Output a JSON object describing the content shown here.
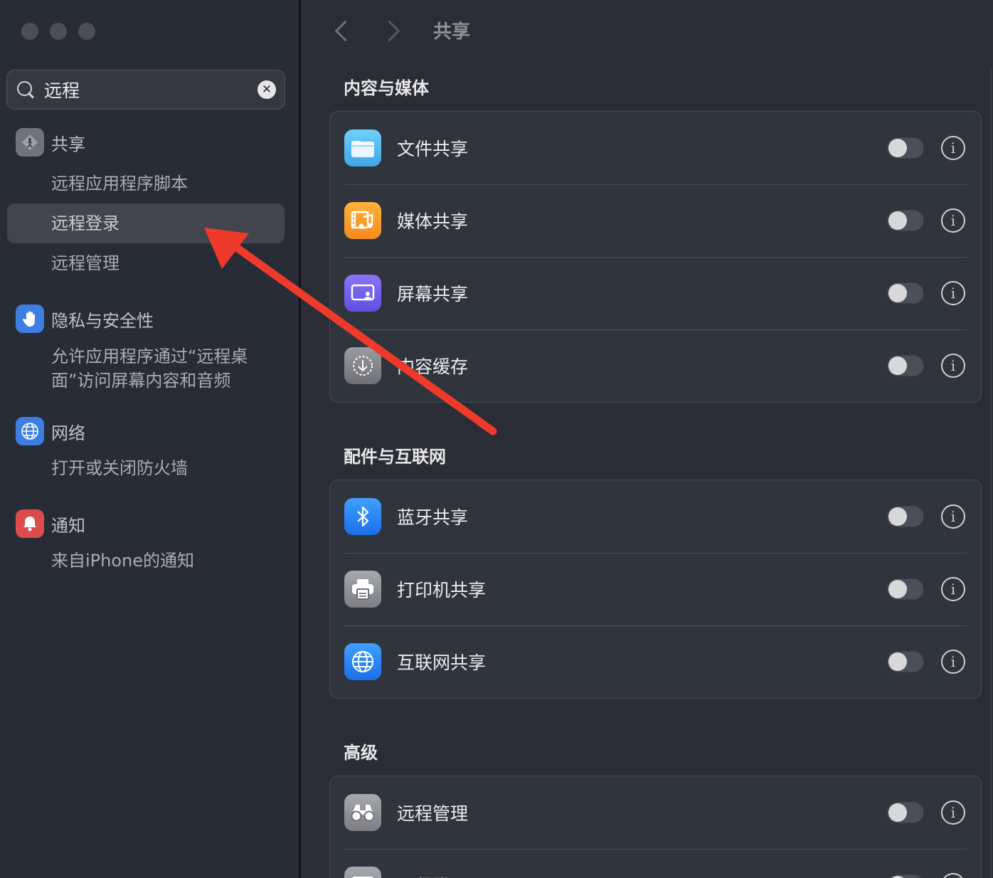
{
  "search": {
    "query": "远程",
    "clear_icon": "xmark-circle-icon"
  },
  "sidebar": {
    "groups": [
      {
        "label": "共享",
        "icon": "sharing-icon",
        "color": "#7b7f88",
        "sub": [
          "远程应用程序脚本",
          "远程登录",
          "远程管理"
        ]
      },
      {
        "label": "隐私与安全性",
        "icon": "hand-icon",
        "color": "#3d7ee0",
        "sub": [
          "允许应用程序通过“远程桌面”访问屏幕内容和音频"
        ]
      },
      {
        "label": "网络",
        "icon": "globe-icon",
        "color": "#3d7ee0",
        "sub": [
          "打开或关闭防火墙"
        ]
      },
      {
        "label": "通知",
        "icon": "bell-icon",
        "color": "#e05050",
        "sub": [
          "来自iPhone的通知"
        ]
      }
    ],
    "selected": "远程登录"
  },
  "toolbar": {
    "title": "共享"
  },
  "sections": [
    {
      "title": "内容与媒体",
      "items": [
        {
          "label": "文件共享",
          "icon": "folder-icon",
          "enabled": false
        },
        {
          "label": "媒体共享",
          "icon": "media-icon",
          "enabled": false
        },
        {
          "label": "屏幕共享",
          "icon": "screen-share-icon",
          "enabled": false
        },
        {
          "label": "内容缓存",
          "icon": "download-icon",
          "enabled": false
        }
      ]
    },
    {
      "title": "配件与互联网",
      "items": [
        {
          "label": "蓝牙共享",
          "icon": "bluetooth-icon",
          "enabled": false
        },
        {
          "label": "打印机共享",
          "icon": "printer-icon",
          "enabled": false
        },
        {
          "label": "互联网共享",
          "icon": "globe-icon",
          "enabled": false
        }
      ]
    },
    {
      "title": "高级",
      "items": [
        {
          "label": "远程管理",
          "icon": "binoculars-icon",
          "enabled": false
        },
        {
          "label": "远程登录",
          "icon": "terminal-icon",
          "enabled": false
        }
      ]
    }
  ],
  "colors": {
    "arrow": "#ee3a2b",
    "accent": "#3d7ee0"
  }
}
